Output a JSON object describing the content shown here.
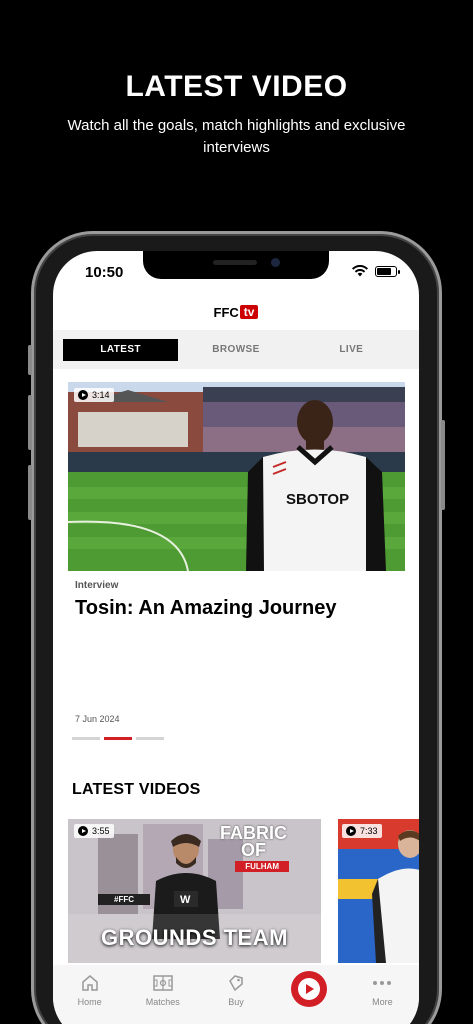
{
  "promo": {
    "title": "LATEST VIDEO",
    "subtitle": "Watch all the goals, match highlights and exclusive interviews"
  },
  "status_bar": {
    "time": "10:50"
  },
  "header": {
    "logo_ffc": "FFC",
    "logo_tv": "tv"
  },
  "tabs": [
    {
      "label": "LATEST",
      "active": true
    },
    {
      "label": "BROWSE",
      "active": false
    },
    {
      "label": "LIVE",
      "active": false
    }
  ],
  "featured": {
    "duration": "3:14",
    "category": "Interview",
    "title": "Tosin: An Amazing Journey",
    "date": "7 Jun 2024",
    "shirt_sponsor": "SBOTOP",
    "carousel": {
      "count": 3,
      "active_index": 1
    }
  },
  "latest_videos": {
    "title": "LATEST VIDEOS",
    "items": [
      {
        "duration": "3:55",
        "overlay_title_line1": "FABRIC",
        "overlay_title_line2": "OF",
        "overlay_tag": "FULHAM",
        "hashtag": "#FFC",
        "caption": "GROUNDS TEAM"
      },
      {
        "duration": "7:33"
      }
    ]
  },
  "bottom_nav": [
    {
      "label": "Home",
      "icon": "home-icon"
    },
    {
      "label": "Matches",
      "icon": "pitch-icon"
    },
    {
      "label": "Buy",
      "icon": "tag-icon"
    },
    {
      "label": "",
      "icon": "play-button-icon"
    },
    {
      "label": "More",
      "icon": "more-dots-icon"
    }
  ],
  "colors": {
    "accent": "#d21f26",
    "background": "#000000"
  }
}
